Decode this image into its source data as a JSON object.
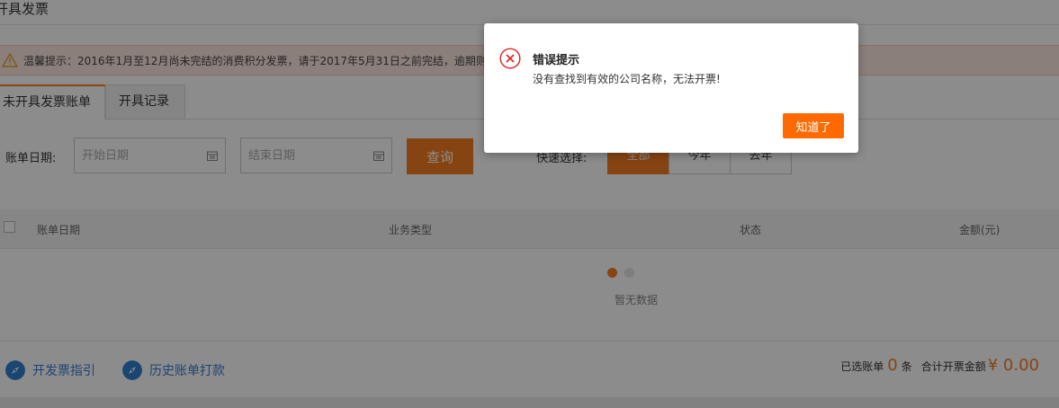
{
  "header": {
    "title": "开具发票"
  },
  "notice": {
    "icon": "warning-icon",
    "text": "温馨提示：2016年1月至12月尚未完结的消费积分发票，请于2017年5月31日之前完结，逾期则会"
  },
  "tabs": [
    {
      "label": "未开具发票账单",
      "active": true
    },
    {
      "label": "开具记录",
      "active": false
    }
  ],
  "filter": {
    "date_label": "账单日期:",
    "start_placeholder": "开始日期",
    "end_placeholder": "结束日期",
    "query_label": "查询",
    "quick_label": "快速选择:",
    "quick_options": [
      "全部",
      "今年",
      "去年"
    ],
    "quick_selected": "全部"
  },
  "table": {
    "columns": [
      "账单日期",
      "业务类型",
      "状态",
      "金额(元)"
    ],
    "empty_text": "暂无数据"
  },
  "footer": {
    "links": [
      "开发票指引",
      "历史账单打款"
    ],
    "selected_prefix": "已选账单",
    "selected_count": "0",
    "selected_suffix": "条",
    "total_label": "合计开票金额",
    "total_amount": "¥ 0.00"
  },
  "dialog": {
    "icon": "error-icon",
    "title": "错误提示",
    "message": "没有查找到有效的公司名称，无法开票!",
    "confirm_label": "知道了"
  },
  "colors": {
    "accent": "#f57c22",
    "dialog_button": "#ff6a00",
    "link": "#3a7bd5",
    "error": "#e02020"
  }
}
